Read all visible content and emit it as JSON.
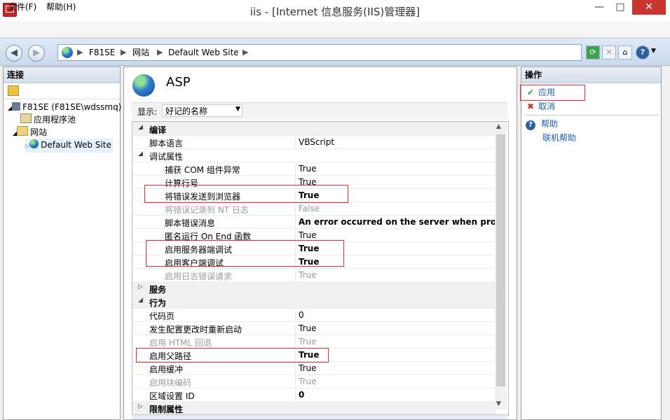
{
  "window": {
    "title": "iis - [Internet 信息服务(IIS)管理器]",
    "min_glyph": "—",
    "max_glyph": "□",
    "close_glyph": "✕"
  },
  "menu": [
    "文件(F)",
    "帮助(H)"
  ],
  "address": {
    "crumbs": [
      "F81SE",
      "网站",
      "Default Web Site"
    ],
    "separator": "▶"
  },
  "left_panel": {
    "header": "连接",
    "tree": [
      {
        "label": "F81SE (F81SE\\wdssmq)",
        "icon": "server-icon"
      },
      {
        "label": "应用程序池",
        "icon": "app-pool-icon"
      },
      {
        "label": "网站",
        "icon": "sites-folder-icon"
      },
      {
        "label": "Default Web Site",
        "icon": "globe-icon"
      }
    ]
  },
  "center": {
    "title": "ASP",
    "display_label": "显示:",
    "display_value": "好记的名称",
    "rows": [
      {
        "type": "cat",
        "exp": "◢",
        "name": "编译",
        "value": "",
        "indent": 0
      },
      {
        "type": "prop",
        "name": "脚本语言",
        "value": "VBScript",
        "indent": 1
      },
      {
        "type": "sub",
        "exp": "◢",
        "name": "调试属性",
        "value": "",
        "indent": 1
      },
      {
        "type": "prop",
        "name": "捕获 COM 组件异常",
        "value": "True",
        "indent": 2
      },
      {
        "type": "prop",
        "name": "计算行号",
        "value": "True",
        "indent": 2
      },
      {
        "type": "bold",
        "name": "将错误发送到浏览器",
        "value": "True",
        "indent": 2
      },
      {
        "type": "dim",
        "name": "将错误记录到 NT 日志",
        "value": "False",
        "indent": 2
      },
      {
        "type": "bold",
        "name": "脚本错误消息",
        "value": "An error occurred on the server when processi",
        "indent": 2
      },
      {
        "type": "prop",
        "name": "匿名运行 On End 函数",
        "value": "True",
        "indent": 2
      },
      {
        "type": "bold",
        "name": "启用服务器端调试",
        "value": "True",
        "indent": 2
      },
      {
        "type": "bold",
        "name": "启用客户端调试",
        "value": "True",
        "indent": 2
      },
      {
        "type": "dim",
        "name": "启用日志错误请求",
        "value": "True",
        "indent": 2
      },
      {
        "type": "cat",
        "exp": "▷",
        "name": "服务",
        "value": "",
        "indent": 0
      },
      {
        "type": "cat",
        "exp": "◢",
        "name": "行为",
        "value": "",
        "indent": 0
      },
      {
        "type": "prop",
        "name": "代码页",
        "value": "0",
        "indent": 1
      },
      {
        "type": "prop",
        "name": "发生配置更改时重新启动",
        "value": "True",
        "indent": 1
      },
      {
        "type": "dim",
        "name": "启用 HTML 回退",
        "value": "True",
        "indent": 1
      },
      {
        "type": "bold",
        "name": "启用父路径",
        "value": "True",
        "indent": 1
      },
      {
        "type": "prop",
        "name": "启用缓冲",
        "value": "True",
        "indent": 1
      },
      {
        "type": "dim",
        "name": "启用块编码",
        "value": "True",
        "indent": 1
      },
      {
        "type": "bold",
        "name": "区域设置 ID",
        "value": "0",
        "indent": 1
      },
      {
        "type": "cat",
        "exp": "▷",
        "name": "限制属性",
        "value": "",
        "indent": 0
      }
    ]
  },
  "right_panel": {
    "header": "操作",
    "actions": [
      {
        "label": "应用",
        "icon": "apply-check-icon"
      },
      {
        "label": "取消",
        "icon": "cancel-x-icon"
      },
      {
        "label": "帮助",
        "icon": "help-icon"
      },
      {
        "label": "联机帮助",
        "icon": ""
      }
    ]
  },
  "colors": {
    "link": "#1a5fb4",
    "highlight_box": "#e03030",
    "close_button": "#c7372f"
  }
}
